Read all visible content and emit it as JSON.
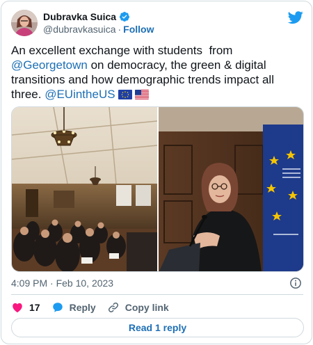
{
  "author": {
    "display_name": "Dubravka Suica",
    "handle": "@dubravkasuica",
    "separator": "·",
    "follow_label": "Follow"
  },
  "tweet": {
    "text_1": "An excellent exchange with students  from ",
    "mention_1": "@Georgetown",
    "text_2": " on democracy, the green & digital transitions and how demographic trends impact all three. ",
    "mention_2": "@EUintheUS",
    "flags": [
      "eu-flag-emoji",
      "us-flag-emoji"
    ]
  },
  "media": {
    "photos": [
      "conference-room-audience-photo",
      "speaker-at-podium-photo"
    ]
  },
  "meta": {
    "timestamp": "4:09 PM · Feb 10, 2023"
  },
  "actions": {
    "like_count": "17",
    "reply_label": "Reply",
    "copy_link_label": "Copy link"
  },
  "read_replies_label": "Read 1 reply",
  "colors": {
    "link": "#1d6fb5",
    "verified": "#1d9bf0",
    "like": "#f91880",
    "twitter": "#1d9bf0",
    "muted": "#536471",
    "border": "#cfd9de"
  }
}
